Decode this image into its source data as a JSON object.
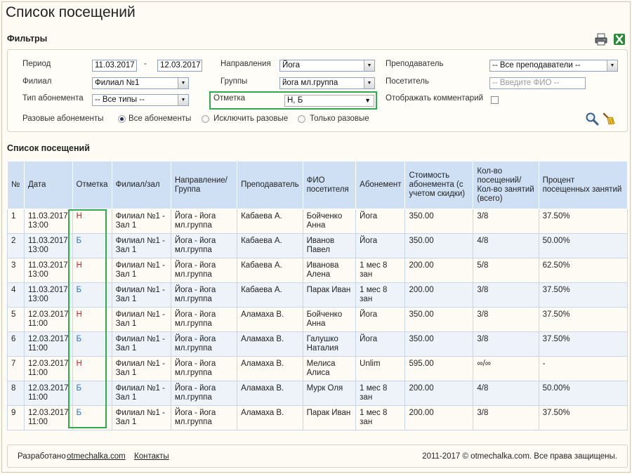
{
  "page_title": "Список посещений",
  "filters": {
    "title": "Фильтры",
    "period_label": "Период",
    "period_from": "11.03.2017",
    "period_sep": "-",
    "period_to": "12.03.2017",
    "branch_label": "Филиал",
    "branch_value": "Филиал №1",
    "subscription_type_label": "Тип абонемента",
    "subscription_type_value": "-- Все типы --",
    "directions_label": "Направления",
    "directions_value": "Йога",
    "groups_label": "Группы",
    "groups_value": "йога мл.группа",
    "mark_label": "Отметка",
    "mark_value": "Н, Б",
    "teacher_label": "Преподаватель",
    "teacher_value": "-- Все преподаватели --",
    "visitor_label": "Посетитель",
    "visitor_placeholder": "-- Введите ФИО --",
    "show_comments_label": "Отображать комментарий",
    "one_time_label": "Разовые абонементы",
    "radio_all": "Все абонементы",
    "radio_exclude": "Исключить разовые",
    "radio_only": "Только разовые"
  },
  "icons": {
    "print": "printer-icon",
    "excel": "excel-icon",
    "search": "magnifier-icon",
    "clear": "broom-icon"
  },
  "colors": {
    "mark_n": "#d4202a",
    "mark_b": "#2a73c8",
    "highlight": "#2fab4d",
    "header_bg": "#cfe0f5"
  },
  "list": {
    "title": "Список посещений",
    "columns": [
      "№",
      "Дата",
      "Отметка",
      "Филиал/зал",
      "Направление/ Группа",
      "Преподаватель",
      "ФИО посетителя",
      "Абонемент",
      "Стоимость абонемента (с учетом скидки)",
      "Кол-во посещений/ Кол-во занятий (всего)",
      "Процент посещенных занятий"
    ],
    "rows": [
      {
        "num": "1",
        "date": "11.03.2017",
        "time": "13:00",
        "mark": "Н",
        "branch": "Филиал №1 -",
        "hall": "Зал 1",
        "dir": "Йога - йога",
        "grp": "мл.группа",
        "teacher": "Кабаева А.",
        "fio1": "Бойченко",
        "fio2": "Анна",
        "sub": "Йога",
        "price": "350.00",
        "count": "3/8",
        "pct": "37.50%"
      },
      {
        "num": "2",
        "date": "11.03.2017",
        "time": "13:00",
        "mark": "Б",
        "branch": "Филиал №1 -",
        "hall": "Зал 1",
        "dir": "Йога - йога",
        "grp": "мл.группа",
        "teacher": "Кабаева А.",
        "fio1": "Иванов",
        "fio2": "Павел",
        "sub": "Йога",
        "price": "350.00",
        "count": "4/8",
        "pct": "50.00%"
      },
      {
        "num": "3",
        "date": "11.03.2017",
        "time": "13:00",
        "mark": "Н",
        "branch": "Филиал №1 -",
        "hall": "Зал 1",
        "dir": "Йога - йога",
        "grp": "мл.группа",
        "teacher": "Кабаева А.",
        "fio1": "Иванова",
        "fio2": "Алена",
        "sub": "1 мес 8 зан",
        "price": "200.00",
        "count": "5/8",
        "pct": "62.50%"
      },
      {
        "num": "4",
        "date": "11.03.2017",
        "time": "13:00",
        "mark": "Б",
        "branch": "Филиал №1 -",
        "hall": "Зал 1",
        "dir": "Йога - йога",
        "grp": "мл.группа",
        "teacher": "Кабаева А.",
        "fio1": "Парак Иван",
        "fio2": "",
        "sub": "1 мес 8 зан",
        "price": "200.00",
        "count": "3/8",
        "pct": "37.50%"
      },
      {
        "num": "5",
        "date": "12.03.2017",
        "time": "11:00",
        "mark": "Н",
        "branch": "Филиал №1 -",
        "hall": "Зал 1",
        "dir": "Йога - йога",
        "grp": "мл.группа",
        "teacher": "Аламаха В.",
        "fio1": "Бойченко",
        "fio2": "Анна",
        "sub": "Йога",
        "price": "350.00",
        "count": "3/8",
        "pct": "37.50%"
      },
      {
        "num": "6",
        "date": "12.03.2017",
        "time": "11:00",
        "mark": "Б",
        "branch": "Филиал №1 -",
        "hall": "Зал 1",
        "dir": "Йога - йога",
        "grp": "мл.группа",
        "teacher": "Аламаха В.",
        "fio1": "Галушко",
        "fio2": "Наталия",
        "sub": "Йога",
        "price": "350.00",
        "count": "3/8",
        "pct": "37.50%"
      },
      {
        "num": "7",
        "date": "12.03.2017",
        "time": "11:00",
        "mark": "Н",
        "branch": "Филиал №1 -",
        "hall": "Зал 1",
        "dir": "Йога - йога",
        "grp": "мл.группа",
        "teacher": "Аламаха В.",
        "fio1": "Мелиса",
        "fio2": "Алиса",
        "sub": "Unlim",
        "price": "595.00",
        "count": "∞/∞",
        "pct": "-"
      },
      {
        "num": "8",
        "date": "12.03.2017",
        "time": "11:00",
        "mark": "Б",
        "branch": "Филиал №1 -",
        "hall": "Зал 1",
        "dir": "Йога - йога",
        "grp": "мл.группа",
        "teacher": "Аламаха В.",
        "fio1": "Мурк Оля",
        "fio2": "",
        "sub": "1 мес 8 зан",
        "price": "200.00",
        "count": "4/8",
        "pct": "50.00%"
      },
      {
        "num": "9",
        "date": "12.03.2017",
        "time": "11:00",
        "mark": "Б",
        "branch": "Филиал №1 -",
        "hall": "Зал 1",
        "dir": "Йога - йога",
        "grp": "мл.группа",
        "teacher": "Аламаха В.",
        "fio1": "Парак Иван",
        "fio2": "",
        "sub": "1 мес 8 зан",
        "price": "200.00",
        "count": "3/8",
        "pct": "37.50%"
      }
    ]
  },
  "footer": {
    "developed_by": "Разработано",
    "site_link": "otmechalka.com",
    "contacts": "Контакты",
    "copyright": "2011-2017 © otmechalka.com. Все права защищены."
  }
}
